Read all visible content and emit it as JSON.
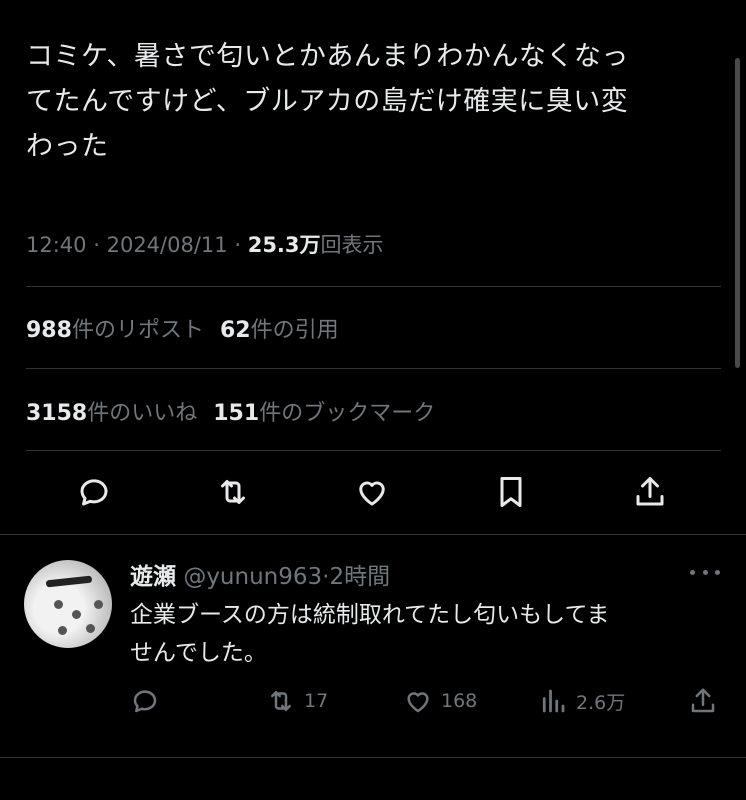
{
  "tweet": {
    "text": "コミケ、暑さで匂いとかあんまりわかんなくなっ\nてたんですけど、ブルアカの島だけ確実に臭い変\nわった",
    "time": "12:40",
    "date": "2024/08/11",
    "views": "25.3万",
    "views_suffix": "回表示",
    "sep": "·"
  },
  "stats": {
    "reposts_count": "988",
    "reposts_label": "件のリポスト",
    "quotes_count": "62",
    "quotes_label": "件の引用",
    "likes_count": "3158",
    "likes_label": "件のいいね",
    "bookmarks_count": "151",
    "bookmarks_label": "件のブックマーク"
  },
  "actions": {
    "icons": [
      "reply-icon",
      "repost-icon",
      "like-icon",
      "bookmark-icon",
      "share-icon"
    ],
    "icon_color": "#e7e9ea"
  },
  "reply": {
    "name": "遊瀬",
    "handle": "@yunun963",
    "sep": "·",
    "time": "2時間",
    "text": "企業ブースの方は統制取れてたし匂いもしてま\nせんでした。",
    "retweets": "17",
    "likes": "168",
    "views": "2.6万"
  },
  "colors": {
    "background": "#000000",
    "text": "#e7e9ea",
    "muted": "#71767b",
    "divider": "#2f3336"
  }
}
